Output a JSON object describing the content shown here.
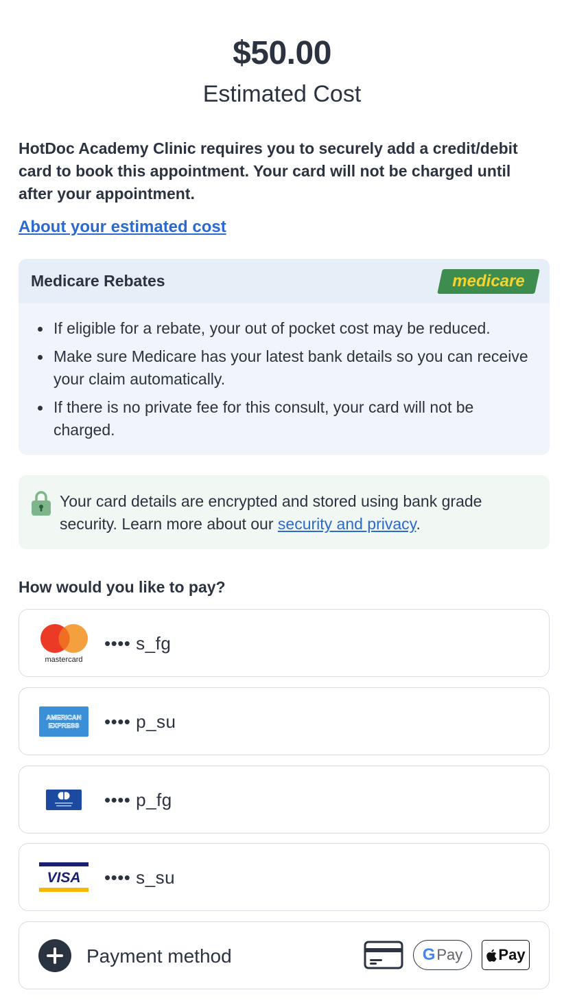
{
  "summary": {
    "price": "$50.00",
    "price_label": "Estimated Cost"
  },
  "intro_text": "HotDoc Academy Clinic requires you to securely add a credit/debit card to book this appointment. Your card will not be charged until after your appointment.",
  "about_link": "About your estimated cost",
  "medicare": {
    "title": "Medicare Rebates",
    "logo_text": "medicare",
    "bullets": [
      "If eligible for a rebate, your out of pocket cost may be reduced.",
      "Make sure Medicare has your latest bank details so you can receive your claim automatically.",
      "If there is no private fee for this consult, your card will not be charged."
    ]
  },
  "security": {
    "text_before": "Your card details are encrypted and stored using bank grade security. Learn more about our ",
    "link": "security and privacy",
    "text_after": "."
  },
  "payment": {
    "question": "How would you like to pay?",
    "cards": [
      {
        "brand": "mastercard",
        "brand_label": "mastercard",
        "masked": "•••• s_fg"
      },
      {
        "brand": "amex",
        "brand_label": "AMERICAN EXPRESS",
        "masked": "•••• p_su"
      },
      {
        "brand": "diners",
        "brand_label": "Diners Club International",
        "masked": "•••• p_fg"
      },
      {
        "brand": "visa",
        "brand_label": "VISA",
        "masked": "•••• s_su"
      }
    ],
    "add_method_label": "Payment method",
    "gpay_label": "Pay",
    "applepay_label": "Pay"
  },
  "colors": {
    "link": "#2a6ad0",
    "text": "#2b3240",
    "medicare_green": "#3e8d4e",
    "medicare_yellow": "#f6d32f"
  }
}
